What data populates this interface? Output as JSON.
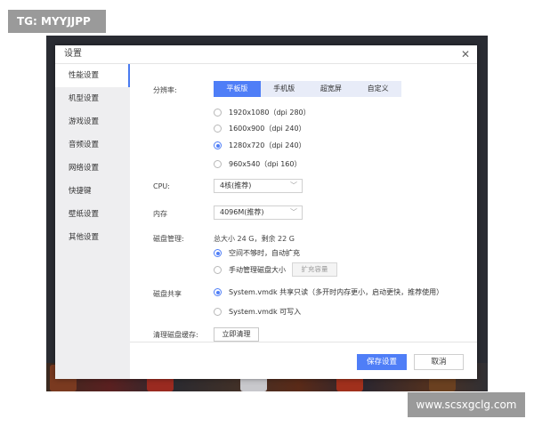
{
  "overlays": {
    "top_left": "TG: MYYJJPP",
    "bottom_right": "www.scsxgclg.com"
  },
  "dialog": {
    "title": "设置",
    "close": "✕"
  },
  "sidebar": {
    "items": [
      {
        "label": "性能设置",
        "active": true
      },
      {
        "label": "机型设置"
      },
      {
        "label": "游戏设置"
      },
      {
        "label": "音频设置"
      },
      {
        "label": "网络设置"
      },
      {
        "label": "快捷键"
      },
      {
        "label": "壁纸设置"
      },
      {
        "label": "其他设置"
      }
    ]
  },
  "resolution": {
    "label": "分辨率:",
    "tabs": [
      "平板版",
      "手机版",
      "超宽屏",
      "自定义"
    ],
    "active_tab": "平板版",
    "options": [
      {
        "label": "1920x1080（dpi 280）",
        "selected": false
      },
      {
        "label": "1600x900（dpi 240）",
        "selected": false
      },
      {
        "label": "1280x720（dpi 240）",
        "selected": true
      },
      {
        "label": "960x540（dpi 160）",
        "selected": false
      }
    ]
  },
  "cpu": {
    "label": "CPU:",
    "value": "4核(推荐)"
  },
  "memory": {
    "label": "内存",
    "value": "4096M(推荐)"
  },
  "disk": {
    "label": "磁盘管理:",
    "summary": "总大小 24 G，剩余 22 G",
    "options": [
      {
        "label": "空间不够时，自动扩充",
        "selected": true
      },
      {
        "label": "手动管理磁盘大小",
        "selected": false
      }
    ],
    "expand_button": "扩充容量"
  },
  "disk_share": {
    "label": "磁盘共享",
    "options": [
      {
        "label": "System.vmdk 共享只读（多开时内存更小，启动更快，推荐使用）",
        "selected": true
      },
      {
        "label": "System.vmdk 可写入",
        "selected": false
      }
    ]
  },
  "cache": {
    "label": "清理磁盘缓存:",
    "button": "立即清理"
  },
  "footer": {
    "save": "保存设置",
    "cancel": "取消"
  },
  "colors": {
    "accent": "#4f7ef7",
    "sidebar_bg": "#eeeef0"
  }
}
